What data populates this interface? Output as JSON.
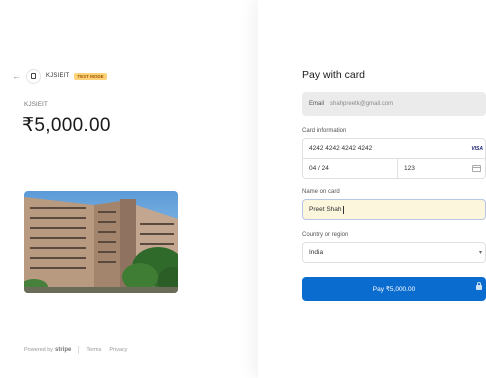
{
  "merchant": {
    "back_icon": "arrow-left-icon",
    "name": "KJSIEIT",
    "badge": "TEST MODE"
  },
  "product": {
    "name": "KJSIEIT",
    "price": "₹5,000.00",
    "image": "college-building-photo"
  },
  "footer": {
    "powered_by": "Powered by",
    "brand": "stripe",
    "terms": "Terms",
    "privacy": "Privacy"
  },
  "payment": {
    "title": "Pay with card",
    "email_label": "Email",
    "email_value": "shahpreetk@gmail.com",
    "card_info_label": "Card information",
    "card_number": "4242 4242 4242 4242",
    "card_brand": "VISA",
    "expiry": "04 / 24",
    "cvc": "123",
    "name_label": "Name on card",
    "name_value": "Preet Shah",
    "country_label": "Country or region",
    "country_value": "India",
    "pay_button": "Pay ₹5,000.00"
  },
  "colors": {
    "accent": "#0a6ccf",
    "badge_bg": "#ffd27a",
    "badge_text": "#9a5a00"
  }
}
